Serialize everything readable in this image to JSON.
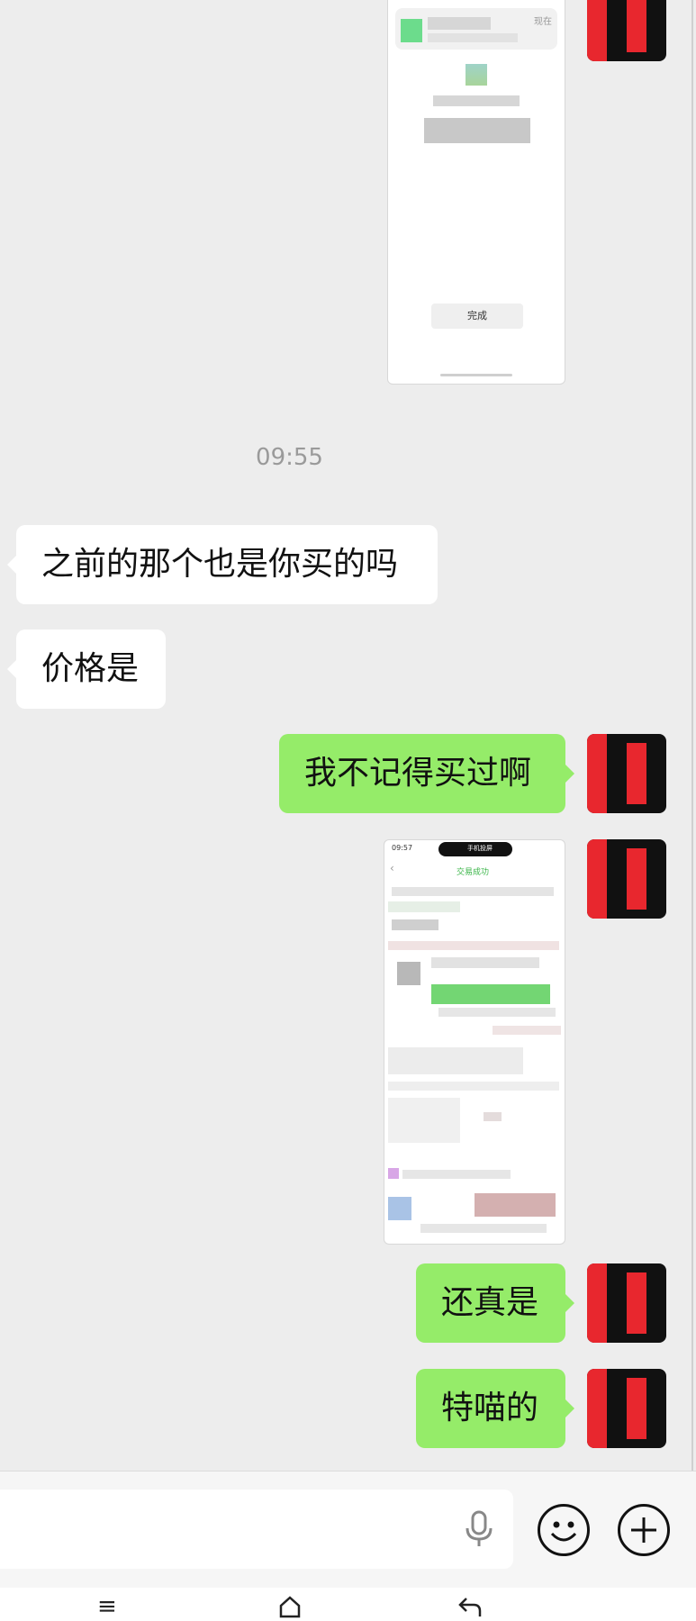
{
  "chat": {
    "time_separator": "09:55",
    "messages": [
      {
        "side": "left",
        "text": "之前的那个也是你买的吗"
      },
      {
        "side": "left",
        "text": "价格是"
      },
      {
        "side": "right",
        "text": "我不记得买过啊"
      },
      {
        "side": "right",
        "text": "还真是"
      },
      {
        "side": "right",
        "text": "特喵的"
      }
    ],
    "screenshot1": {
      "button": "完成",
      "tag": "现在"
    },
    "screenshot2": {
      "status_time": "09:57",
      "status_label": "手机投屏",
      "title": "交易成功"
    }
  },
  "colors": {
    "sent_bubble": "#95ec69",
    "received_bubble": "#ffffff",
    "background": "#ededed",
    "avatar_red": "#e8272e"
  },
  "icons": {
    "voice": "microphone-icon",
    "emoji": "smiley-icon",
    "more": "plus-icon",
    "nav_menu": "menu-icon",
    "nav_home": "home-icon",
    "nav_back": "back-icon"
  }
}
